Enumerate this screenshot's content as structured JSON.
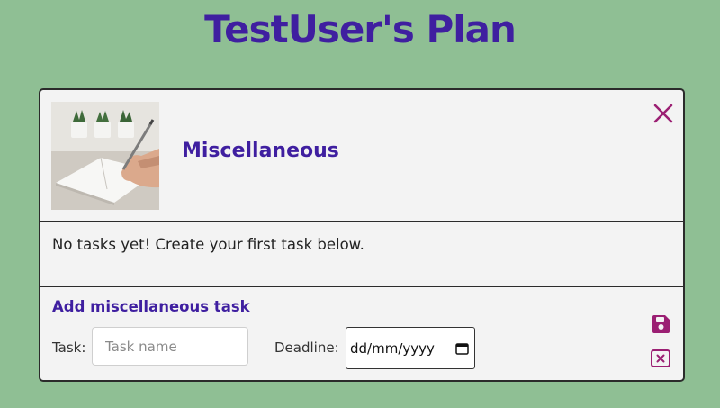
{
  "header": {
    "title": "TestUser's Plan"
  },
  "category": {
    "title": "Miscellaneous",
    "image_description": "notebook-with-pen-and-plants"
  },
  "tasks": {
    "empty_message": "No tasks yet! Create your first task below."
  },
  "form": {
    "heading": "Add miscellaneous task",
    "task_label": "Task:",
    "task_placeholder": "Task name",
    "task_value": "",
    "deadline_label": "Deadline:",
    "deadline_value": "dd/mm/yyyy"
  },
  "icons": {
    "close": "close-icon",
    "save": "floppy-disk-icon",
    "cancel": "cancel-square-icon",
    "calendar": "calendar-icon"
  },
  "colors": {
    "background": "#8fbf94",
    "accent": "#3f1fa0",
    "action": "#9b1f73",
    "card": "#f3f3f3"
  }
}
